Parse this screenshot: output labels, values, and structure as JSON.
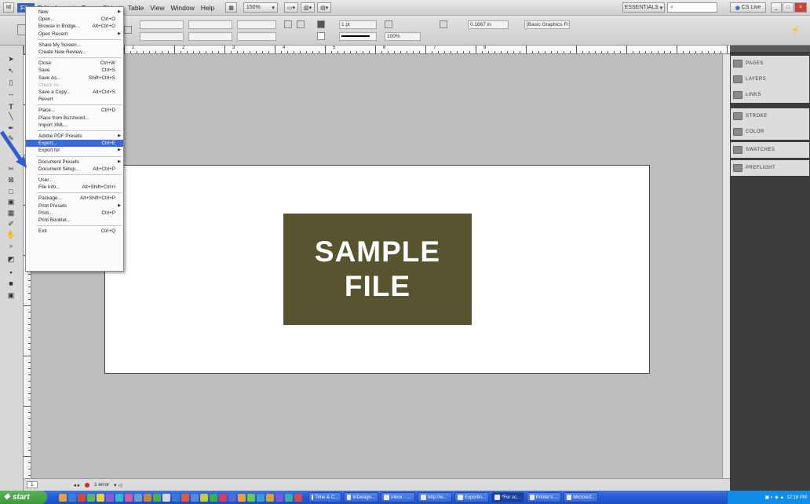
{
  "menubar": {
    "items": [
      "File",
      "Edit",
      "Layout",
      "Type",
      "Object",
      "Table",
      "View",
      "Window",
      "Help"
    ],
    "zoom": "150%",
    "workspace": "ESSENTIALS",
    "cslive": "CS Live"
  },
  "control_panel": {
    "stroke_weight": "1 pt",
    "opacity": "100%",
    "measure": "0.1667 in",
    "frame_style": "[Basic Graphics Frame]+"
  },
  "page": {
    "sample_line1": "SAMPLE",
    "sample_line2": "FILE"
  },
  "file_menu": [
    {
      "label": "New",
      "shortcut": "",
      "arrow": true,
      "disabled": false,
      "hl": false
    },
    {
      "label": "Open...",
      "shortcut": "Ctrl+O",
      "arrow": false,
      "disabled": false,
      "hl": false
    },
    {
      "label": "Browse in Bridge...",
      "shortcut": "Alt+Ctrl+O",
      "arrow": false,
      "disabled": false,
      "hl": false
    },
    {
      "label": "Open Recent",
      "shortcut": "",
      "arrow": true,
      "disabled": false,
      "hl": false
    },
    {
      "sep": true
    },
    {
      "label": "Share My Screen...",
      "shortcut": "",
      "arrow": false,
      "disabled": false,
      "hl": false
    },
    {
      "label": "Create New Review...",
      "shortcut": "",
      "arrow": false,
      "disabled": false,
      "hl": false
    },
    {
      "sep": true
    },
    {
      "label": "Close",
      "shortcut": "Ctrl+W",
      "arrow": false,
      "disabled": false,
      "hl": false
    },
    {
      "label": "Save",
      "shortcut": "Ctrl+S",
      "arrow": false,
      "disabled": false,
      "hl": false
    },
    {
      "label": "Save As...",
      "shortcut": "Shift+Ctrl+S",
      "arrow": false,
      "disabled": false,
      "hl": false
    },
    {
      "label": "Check In...",
      "shortcut": "",
      "arrow": false,
      "disabled": true,
      "hl": false
    },
    {
      "label": "Save a Copy...",
      "shortcut": "Alt+Ctrl+S",
      "arrow": false,
      "disabled": false,
      "hl": false
    },
    {
      "label": "Revert",
      "shortcut": "",
      "arrow": false,
      "disabled": false,
      "hl": false
    },
    {
      "sep": true
    },
    {
      "label": "Place...",
      "shortcut": "Ctrl+D",
      "arrow": false,
      "disabled": false,
      "hl": false
    },
    {
      "label": "Place from Buzzword...",
      "shortcut": "",
      "arrow": false,
      "disabled": false,
      "hl": false
    },
    {
      "label": "Import XML...",
      "shortcut": "",
      "arrow": false,
      "disabled": false,
      "hl": false
    },
    {
      "sep": true
    },
    {
      "label": "Adobe PDF Presets",
      "shortcut": "",
      "arrow": true,
      "disabled": false,
      "hl": false
    },
    {
      "label": "Export...",
      "shortcut": "Ctrl+E",
      "arrow": false,
      "disabled": false,
      "hl": true
    },
    {
      "label": "Export for",
      "shortcut": "",
      "arrow": true,
      "disabled": false,
      "hl": false
    },
    {
      "sep": true
    },
    {
      "label": "Document Presets",
      "shortcut": "",
      "arrow": true,
      "disabled": false,
      "hl": false
    },
    {
      "label": "Document Setup...",
      "shortcut": "Alt+Ctrl+P",
      "arrow": false,
      "disabled": false,
      "hl": false
    },
    {
      "sep": true
    },
    {
      "label": "User...",
      "shortcut": "",
      "arrow": false,
      "disabled": false,
      "hl": false
    },
    {
      "label": "File Info...",
      "shortcut": "Alt+Shift+Ctrl+I",
      "arrow": false,
      "disabled": false,
      "hl": false
    },
    {
      "sep": true
    },
    {
      "label": "Package...",
      "shortcut": "Alt+Shift+Ctrl+P",
      "arrow": false,
      "disabled": false,
      "hl": false
    },
    {
      "label": "Print Presets",
      "shortcut": "",
      "arrow": true,
      "disabled": false,
      "hl": false
    },
    {
      "label": "Print...",
      "shortcut": "Ctrl+P",
      "arrow": false,
      "disabled": false,
      "hl": false
    },
    {
      "label": "Print Booklet...",
      "shortcut": "",
      "arrow": false,
      "disabled": false,
      "hl": false
    },
    {
      "sep": true
    },
    {
      "label": "Exit",
      "shortcut": "Ctrl+Q",
      "arrow": false,
      "disabled": false,
      "hl": false
    }
  ],
  "panels": [
    {
      "label": "PAGES",
      "icon": "pages-icon"
    },
    {
      "label": "LAYERS",
      "icon": "layers-icon"
    },
    {
      "label": "LINKS",
      "icon": "links-icon"
    },
    {
      "label": "STROKE",
      "icon": "stroke-icon"
    },
    {
      "label": "COLOR",
      "icon": "color-icon"
    },
    {
      "label": "SWATCHES",
      "icon": "swatches-icon"
    },
    {
      "label": "PREFLIGHT",
      "icon": "preflight-icon"
    }
  ],
  "ruler_labels": [
    "1",
    "2",
    "3",
    "4",
    "5",
    "6",
    "7",
    "8"
  ],
  "status": {
    "page": "1",
    "errors": "1 error"
  },
  "taskbar": {
    "start": "start",
    "tasks": [
      "Time & C...",
      "InDesign...",
      "Inbox - ...",
      "http://w...",
      "Exportin...",
      "*For sc...",
      "Printer's ...",
      "Microsof..."
    ],
    "clock": "12:18 PM"
  }
}
